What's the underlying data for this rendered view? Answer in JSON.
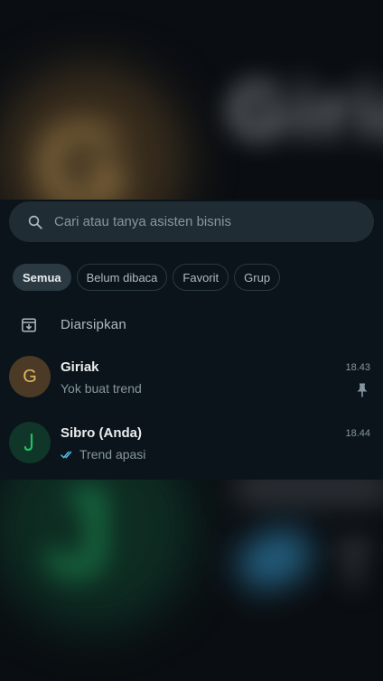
{
  "search": {
    "placeholder": "Cari atau tanya asisten bisnis"
  },
  "filters": {
    "items": [
      "Semua",
      "Belum dibaca",
      "Favorit",
      "Grup"
    ],
    "active": "Semua"
  },
  "archived": {
    "label": "Diarsipkan",
    "icon": "archive-icon"
  },
  "chats": [
    {
      "name": "Giriak",
      "avatar_letter": "G",
      "preview": "Yok buat trend",
      "time": "18.43",
      "pinned": true,
      "avatar_color": "#4b3b26"
    },
    {
      "name": "Sibro (Anda)",
      "avatar_letter": "J",
      "preview": "Trend apasi",
      "time": "18.44",
      "read_ticks": true,
      "avatar_color": "#103529"
    }
  ],
  "colors": {
    "background": "#0b141a",
    "search_bg": "#202c33",
    "accent_green": "#21c063",
    "read_tick_blue": "#53bdeb"
  }
}
